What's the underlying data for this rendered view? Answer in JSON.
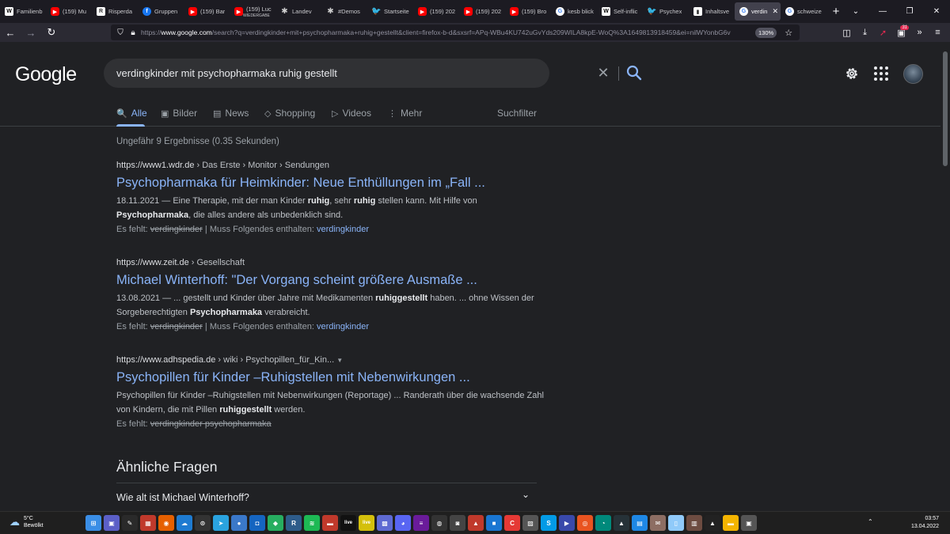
{
  "browser": {
    "tabs": [
      {
        "icon": "wikipedia-icon",
        "favclass": "wp",
        "glyph": "W",
        "title": "Familienb"
      },
      {
        "icon": "youtube-icon",
        "favclass": "yt",
        "glyph": "▶",
        "title": "(159) Mu"
      },
      {
        "icon": "website-icon",
        "favclass": "rs",
        "glyph": "R",
        "title": "Risperda"
      },
      {
        "icon": "facebook-icon",
        "favclass": "fb",
        "glyph": "f",
        "title": "Gruppen"
      },
      {
        "icon": "youtube-icon",
        "favclass": "yt",
        "glyph": "▶",
        "title": "(159) Bar"
      },
      {
        "icon": "youtube-icon",
        "favclass": "yt",
        "glyph": "▶",
        "title": "(159) Luc"
      },
      {
        "icon": "asterisk-icon",
        "favclass": "dk",
        "glyph": "✱",
        "title": "Landev"
      },
      {
        "icon": "asterisk-icon",
        "favclass": "dk",
        "glyph": "✱",
        "title": "#Demos"
      },
      {
        "icon": "twitter-icon",
        "favclass": "tw",
        "glyph": "🐦",
        "title": "Startseite"
      },
      {
        "icon": "youtube-icon",
        "favclass": "yt",
        "glyph": "▶",
        "title": "(159) 202"
      },
      {
        "icon": "youtube-icon",
        "favclass": "yt",
        "glyph": "▶",
        "title": "(159) 202"
      },
      {
        "icon": "youtube-icon",
        "favclass": "yt",
        "glyph": "▶",
        "title": "(159) Bro"
      },
      {
        "icon": "google-icon",
        "favclass": "g",
        "glyph": "G",
        "title": "kesb blick"
      },
      {
        "icon": "wikipedia-icon",
        "favclass": "wp",
        "glyph": "W",
        "title": "Self-inflic"
      },
      {
        "icon": "twitter-icon",
        "favclass": "tw",
        "glyph": "🐦",
        "title": "Psychex"
      },
      {
        "icon": "website-icon",
        "favclass": "rs",
        "glyph": "▮",
        "title": "Inhaltsve"
      },
      {
        "icon": "google-icon",
        "favclass": "g",
        "glyph": "G",
        "title": "verdin",
        "active": true
      },
      {
        "icon": "google-icon",
        "favclass": "g",
        "glyph": "G",
        "title": "schweize"
      }
    ],
    "tab_sublabel": "WIEDERGABE",
    "new_tab": "+",
    "url_prefix": "https://",
    "url_host": "www.google.com",
    "url_rest": "/search?q=verdingkinder+mit+psychopharmaka+ruhig+gestellt&client=firefox-b-d&sxsrf=APq-WBu4KU742uGvYds209WILA8kpE-WoQ%3A1649813918459&ei=nilWYonbG6v",
    "zoom": "130%",
    "extension_badge": "31"
  },
  "google": {
    "logo": "Google",
    "query": "verdingkinder mit psychopharmaka ruhig gestellt",
    "tabs": [
      {
        "label": "Alle",
        "icon": "search-icon",
        "glyph": "🔍",
        "active": true
      },
      {
        "label": "Bilder",
        "icon": "image-icon",
        "glyph": "▣"
      },
      {
        "label": "News",
        "icon": "news-icon",
        "glyph": "▤"
      },
      {
        "label": "Shopping",
        "icon": "tag-icon",
        "glyph": "◇"
      },
      {
        "label": "Videos",
        "icon": "play-icon",
        "glyph": "▷"
      },
      {
        "label": "Mehr",
        "icon": "more-icon",
        "glyph": "⋮"
      }
    ],
    "search_tools": "Suchfilter",
    "stats": "Ungefähr 9 Ergebnisse (0.35 Sekunden)",
    "results": [
      {
        "host": "https://www1.wdr.de",
        "path": " › Das Erste › Monitor › Sendungen",
        "title": "Psychopharmaka für Heimkinder: Neue Enthüllungen im „Fall ...",
        "snippet_html": "18.11.2021 — Eine Therapie, mit der man Kinder <b>ruhig</b>, sehr <b>ruhig</b> stellen kann. Mit Hilfe von <b>Psychopharmaka</b>, die alles andere als unbedenklich sind.",
        "missing_prefix": "Es fehlt: ",
        "missing_struck": "verdingkinder",
        "missing_mid": " | Muss Folgendes enthalten: ",
        "missing_link": "verdingkinder"
      },
      {
        "host": "https://www.zeit.de",
        "path": " › Gesellschaft",
        "title": "Michael Winterhoff: \"Der Vorgang scheint größere Ausmaße ...",
        "snippet_html": "13.08.2021 — ... gestellt und Kinder über Jahre mit Medikamenten <b>ruhiggestellt</b> haben. ... ohne Wissen der Sorgeberechtigten <b>Psychopharmaka</b> verabreicht.",
        "missing_prefix": "Es fehlt: ",
        "missing_struck": "verdingkinder",
        "missing_mid": " | Muss Folgendes enthalten: ",
        "missing_link": "verdingkinder"
      },
      {
        "host": "https://www.adhspedia.de",
        "path": " › wiki › Psychopillen_für_Kin...",
        "title": "Psychopillen für Kinder –Ruhigstellen mit Nebenwirkungen ...",
        "snippet_html": "Psychopillen für Kinder –Ruhigstellen mit Nebenwirkungen (Reportage) ... Randerath über die wachsende Zahl von Kindern, die mit Pillen <b>ruhiggestellt</b> werden.",
        "missing_prefix": "Es fehlt: ",
        "missing_struck": "verdingkinder psychopharmaka",
        "missing_mid": "",
        "missing_link": ""
      }
    ],
    "paa_title": "Ähnliche Fragen",
    "paa_question": "Wie alt ist Michael Winterhoff?"
  },
  "taskbar": {
    "temp": "5°C",
    "weather": "Bewölkt",
    "time": "03:57",
    "date": "13.04.2022",
    "icons": [
      {
        "name": "windows-start-icon",
        "color": "#3a8ee6",
        "glyph": "⊞"
      },
      {
        "name": "teams-icon",
        "color": "#5b5fc7",
        "glyph": "▣"
      },
      {
        "name": "pen-icon",
        "color": "#2a2a2a",
        "glyph": "✎"
      },
      {
        "name": "monitor-app-icon",
        "color": "#c0392b",
        "glyph": "▦"
      },
      {
        "name": "firefox-icon",
        "color": "#e66000",
        "glyph": "◉"
      },
      {
        "name": "cloud-app-icon",
        "color": "#1e7bd1",
        "glyph": "☁"
      },
      {
        "name": "compass-icon",
        "color": "#333333",
        "glyph": "⊙"
      },
      {
        "name": "telegram-icon",
        "color": "#2aa3df",
        "glyph": "➤"
      },
      {
        "name": "chat-icon",
        "color": "#3a78c9",
        "glyph": "●"
      },
      {
        "name": "mixer-icon",
        "color": "#1565c0",
        "glyph": "◘"
      },
      {
        "name": "game-icon",
        "color": "#27ae60",
        "glyph": "◆"
      },
      {
        "name": "r-app-icon",
        "color": "#2e5c8a",
        "glyph": "R"
      },
      {
        "name": "spotify-icon",
        "color": "#1db954",
        "glyph": "≋"
      },
      {
        "name": "news-app-icon",
        "color": "#c0392b",
        "glyph": "▬"
      },
      {
        "name": "live-icon",
        "color": "#111111",
        "glyph": "live"
      },
      {
        "name": "live-yellow-icon",
        "color": "#d4c00b",
        "glyph": "live"
      },
      {
        "name": "save-icon",
        "color": "#5e6ad2",
        "glyph": "▩"
      },
      {
        "name": "discord-icon",
        "color": "#5865f2",
        "glyph": "◕"
      },
      {
        "name": "bars-icon",
        "color": "#6a1b9a",
        "glyph": "≡"
      },
      {
        "name": "obs-icon",
        "color": "#333333",
        "glyph": "◍"
      },
      {
        "name": "camera-icon",
        "color": "#444444",
        "glyph": "◙"
      },
      {
        "name": "pdf-icon",
        "color": "#c0392b",
        "glyph": "▲"
      },
      {
        "name": "box-icon",
        "color": "#1976d2",
        "glyph": "■"
      },
      {
        "name": "c-app-icon",
        "color": "#e53935",
        "glyph": "C"
      },
      {
        "name": "picture-icon",
        "color": "#555555",
        "glyph": "▨"
      },
      {
        "name": "s-app-icon",
        "color": "#039be5",
        "glyph": "S"
      },
      {
        "name": "media-icon",
        "color": "#3949ab",
        "glyph": "▶"
      },
      {
        "name": "ubuntu-icon",
        "color": "#e95420",
        "glyph": "◎"
      },
      {
        "name": "status-icon",
        "color": "#00897b",
        "glyph": "◔"
      },
      {
        "name": "hat-icon",
        "color": "#263238",
        "glyph": "▲"
      },
      {
        "name": "notes-icon",
        "color": "#1e88e5",
        "glyph": "▤"
      },
      {
        "name": "scroll-icon",
        "color": "#8d6e63",
        "glyph": "✉"
      },
      {
        "name": "document-icon",
        "color": "#90caf9",
        "glyph": "▯"
      },
      {
        "name": "library-icon",
        "color": "#6d4c41",
        "glyph": "▥"
      },
      {
        "name": "linux-icon",
        "color": "#222222",
        "glyph": "▲"
      },
      {
        "name": "folder-icon",
        "color": "#f4b400",
        "glyph": "▬"
      },
      {
        "name": "active-app-icon",
        "color": "#555555",
        "glyph": "▣"
      }
    ]
  }
}
